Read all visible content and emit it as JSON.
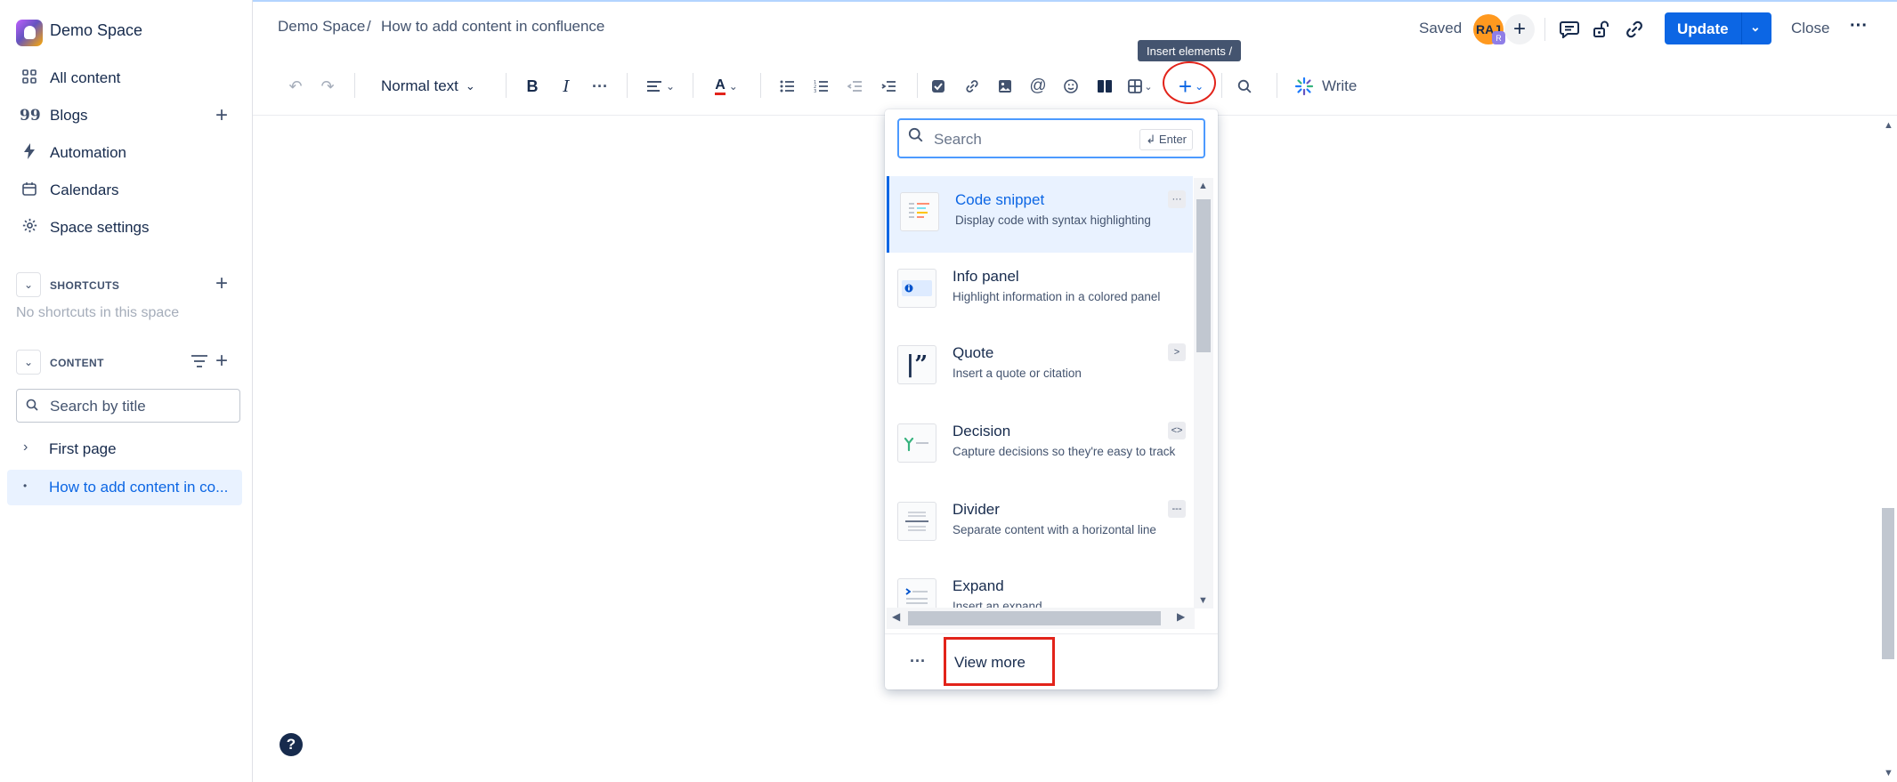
{
  "sidebar": {
    "space_name": "Demo Space",
    "items": [
      {
        "label": "All content",
        "icon": "grid-icon"
      },
      {
        "label": "Blogs",
        "icon": "quote-icon"
      },
      {
        "label": "Automation",
        "icon": "bolt-icon"
      },
      {
        "label": "Calendars",
        "icon": "calendar-icon"
      },
      {
        "label": "Space settings",
        "icon": "gear-icon"
      }
    ],
    "shortcuts": {
      "title": "SHORTCUTS",
      "empty": "No shortcuts in this space"
    },
    "content": {
      "title": "CONTENT",
      "search_placeholder": "Search by title",
      "tree": [
        {
          "label": "First page",
          "active": false
        },
        {
          "label": "How to add content in co...",
          "active": true
        }
      ]
    },
    "help": "?"
  },
  "header": {
    "breadcrumb": [
      "Demo Space",
      "/",
      "How to add content in confluence"
    ],
    "status": "Saved",
    "avatar_initials": "RAJ",
    "avatar_badge": "R",
    "update_label": "Update",
    "close_label": "Close"
  },
  "toolbar": {
    "text_style": "Normal text",
    "tooltip": "Insert elements  /",
    "write_label": "Write"
  },
  "insert_menu": {
    "search_placeholder": "Search",
    "enter_hint": "↲ Enter",
    "items": [
      {
        "title": "Code snippet",
        "desc": "Display code with syntax highlighting",
        "shortcut": "···",
        "icon": "code-snippet-icon",
        "active": true
      },
      {
        "title": "Info panel",
        "desc": "Highlight information in a colored panel",
        "shortcut": "",
        "icon": "info-panel-icon",
        "active": false
      },
      {
        "title": "Quote",
        "desc": "Insert a quote or citation",
        "shortcut": ">",
        "icon": "quote-icon",
        "active": false
      },
      {
        "title": "Decision",
        "desc": "Capture decisions so they're easy to track",
        "shortcut": "<>",
        "icon": "decision-icon",
        "active": false
      },
      {
        "title": "Divider",
        "desc": "Separate content with a horizontal line",
        "shortcut": "---",
        "icon": "divider-icon",
        "active": false
      },
      {
        "title": "Expand",
        "desc": "Insert an expand",
        "shortcut": "",
        "icon": "expand-icon",
        "active": false
      }
    ],
    "view_more": "View more"
  },
  "colors": {
    "accent": "#0c66e4",
    "highlight": "#e2231a",
    "selected_bg": "#e9f2ff"
  }
}
